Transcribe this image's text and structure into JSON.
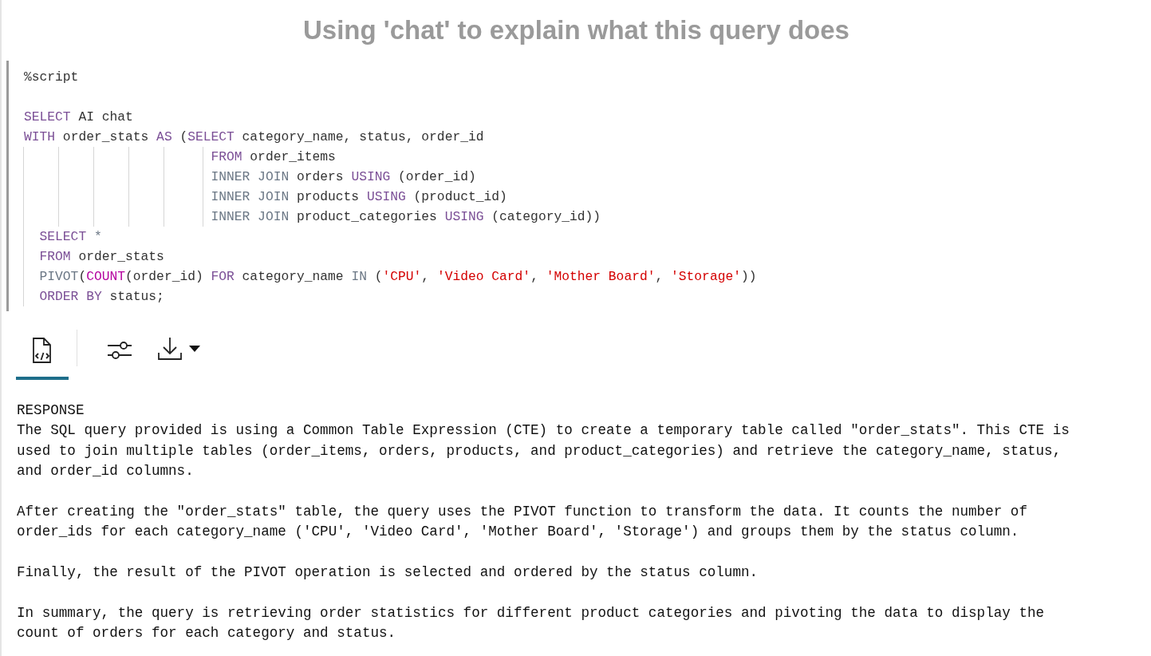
{
  "title": "Using 'chat' to explain what this query does",
  "code": [
    {
      "tokens": [
        {
          "kind": "plain",
          "text": "%script"
        }
      ]
    },
    {
      "kind": "blank"
    },
    {
      "tokens": [
        {
          "kind": "kw",
          "text": "SELECT"
        },
        {
          "kind": "plain",
          "text": " AI chat"
        }
      ]
    },
    {
      "tokens": [
        {
          "kind": "kw",
          "text": "WITH"
        },
        {
          "kind": "plain",
          "text": " order_stats "
        },
        {
          "kind": "kw",
          "text": "AS"
        },
        {
          "kind": "plain",
          "text": " ("
        },
        {
          "kind": "kw",
          "text": "SELECT"
        },
        {
          "kind": "plain",
          "text": " category_name, status, order_id"
        }
      ]
    },
    {
      "kind": "nested",
      "tokens": [
        {
          "kind": "kw",
          "text": "FROM"
        },
        {
          "kind": "plain",
          "text": " order_items"
        }
      ]
    },
    {
      "kind": "nested",
      "tokens": [
        {
          "kind": "op",
          "text": "INNER JOIN"
        },
        {
          "kind": "plain",
          "text": " orders "
        },
        {
          "kind": "kw",
          "text": "USING"
        },
        {
          "kind": "plain",
          "text": " (order_id)"
        }
      ]
    },
    {
      "kind": "nested",
      "tokens": [
        {
          "kind": "op",
          "text": "INNER JOIN"
        },
        {
          "kind": "plain",
          "text": " products "
        },
        {
          "kind": "kw",
          "text": "USING"
        },
        {
          "kind": "plain",
          "text": " (product_id)"
        }
      ]
    },
    {
      "kind": "nested",
      "tokens": [
        {
          "kind": "op",
          "text": "INNER JOIN"
        },
        {
          "kind": "plain",
          "text": " product_categories "
        },
        {
          "kind": "kw",
          "text": "USING"
        },
        {
          "kind": "plain",
          "text": " (category_id))"
        }
      ]
    },
    {
      "kind": "body",
      "tokens": [
        {
          "kind": "kw",
          "text": "SELECT"
        },
        {
          "kind": "op",
          "text": " *"
        }
      ]
    },
    {
      "kind": "body",
      "tokens": [
        {
          "kind": "kw",
          "text": "FROM"
        },
        {
          "kind": "plain",
          "text": " order_stats"
        }
      ]
    },
    {
      "kind": "body",
      "tokens": [
        {
          "kind": "op",
          "text": "PIVOT"
        },
        {
          "kind": "plain",
          "text": "("
        },
        {
          "kind": "fn",
          "text": "COUNT"
        },
        {
          "kind": "plain",
          "text": "(order_id) "
        },
        {
          "kind": "kw",
          "text": "FOR"
        },
        {
          "kind": "plain",
          "text": " category_name "
        },
        {
          "kind": "op",
          "text": "IN"
        },
        {
          "kind": "plain",
          "text": " ("
        },
        {
          "kind": "str",
          "text": "'CPU'"
        },
        {
          "kind": "plain",
          "text": ", "
        },
        {
          "kind": "str",
          "text": "'Video Card'"
        },
        {
          "kind": "plain",
          "text": ", "
        },
        {
          "kind": "str",
          "text": "'Mother Board'"
        },
        {
          "kind": "plain",
          "text": ", "
        },
        {
          "kind": "str",
          "text": "'Storage'"
        },
        {
          "kind": "plain",
          "text": "))"
        }
      ]
    },
    {
      "kind": "body",
      "tokens": [
        {
          "kind": "kw",
          "text": "ORDER BY"
        },
        {
          "kind": "plain",
          "text": " status;"
        }
      ]
    }
  ],
  "toolbar": {
    "tabs": [
      {
        "kind": "code",
        "selected": true
      },
      {
        "kind": "settings",
        "selected": false
      }
    ]
  },
  "response": {
    "label": "RESPONSE",
    "paragraphs": [
      "The SQL query provided is using a Common Table Expression (CTE) to create a temporary table called \"order_stats\". This CTE is\nused to join multiple tables (order_items, orders, products, and product_categories) and retrieve the category_name, status,\nand order_id columns.",
      "After creating the \"order_stats\" table, the query uses the PIVOT function to transform the data. It counts the number of\norder_ids for each category_name ('CPU', 'Video Card', 'Mother Board', 'Storage') and groups them by the status column.",
      "Finally, the result of the PIVOT operation is selected and ordered by the status column.",
      "In summary, the query is retrieving order statistics for different product categories and pivoting the data to display the\ncount of orders for each category and status."
    ]
  }
}
